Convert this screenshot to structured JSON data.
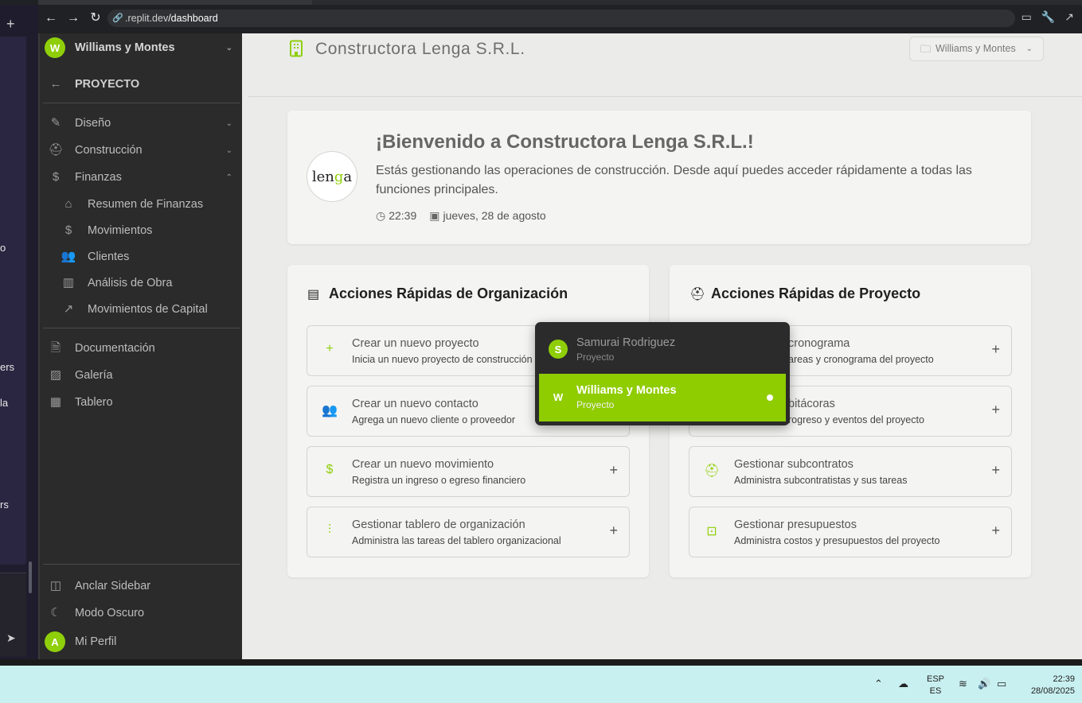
{
  "browser": {
    "url_host": ".replit.dev",
    "url_path": "/dashboard"
  },
  "left_strip": {
    "fragments": [
      "o",
      "ers",
      "la",
      "rs"
    ]
  },
  "sidebar": {
    "org_avatar": "W",
    "org_name": "Williams y Montes",
    "project_label": "PROYECTO",
    "items": [
      {
        "label": "Diseño"
      },
      {
        "label": "Construcción"
      },
      {
        "label": "Finanzas"
      }
    ],
    "finanzas_sub": [
      {
        "label": "Resumen de Finanzas"
      },
      {
        "label": "Movimientos"
      },
      {
        "label": "Clientes"
      },
      {
        "label": "Análisis de Obra"
      },
      {
        "label": "Movimientos de Capital"
      }
    ],
    "items2": [
      {
        "label": "Documentación"
      },
      {
        "label": "Galería"
      },
      {
        "label": "Tablero"
      }
    ],
    "bottom": {
      "pin": "Anclar Sidebar",
      "dark": "Modo Oscuro",
      "profile_avatar": "A",
      "profile": "Mi Perfil"
    }
  },
  "header": {
    "title": "Constructora Lenga S.R.L.",
    "project_select": "Williams y Montes"
  },
  "welcome": {
    "logo_text_a": "len",
    "logo_text_b": "g",
    "logo_text_c": "a",
    "heading": "¡Bienvenido a Constructora Lenga S.R.L.!",
    "text": "Estás gestionando las operaciones de construcción. Desde aquí puedes acceder rápidamente a todas las funciones principales.",
    "time": "22:39",
    "date": "jueves, 28 de agosto"
  },
  "org_actions": {
    "title": "Acciones Rápidas de Organización",
    "items": [
      {
        "title": "Crear un nuevo proyecto",
        "subtitle": "Inicia un nuevo proyecto de construcción"
      },
      {
        "title": "Crear un nuevo contacto",
        "subtitle": "Agrega un nuevo cliente o proveedor"
      },
      {
        "title": "Crear un nuevo movimiento",
        "subtitle": "Registra un ingreso o egreso financiero"
      },
      {
        "title": "Gestionar tablero de organización",
        "subtitle": "Administra las tareas del tablero organizacional"
      }
    ]
  },
  "project_actions": {
    "title": "Acciones Rápidas de Proyecto",
    "items": [
      {
        "title": "cronograma",
        "subtitle": "areas y cronograma del proyecto"
      },
      {
        "title": "bitácoras",
        "subtitle": "rogreso y eventos del proyecto"
      },
      {
        "title": "Gestionar subcontratos",
        "subtitle": "Administra subcontratistas y sus tareas"
      },
      {
        "title": "Gestionar presupuestos",
        "subtitle": "Administra costos y presupuestos del proyecto"
      }
    ]
  },
  "project_dropdown": {
    "items": [
      {
        "avatar": "S",
        "name": "Samurai Rodriguez",
        "role": "Proyecto"
      },
      {
        "avatar": "W",
        "name": "Williams y Montes",
        "role": "Proyecto"
      }
    ]
  },
  "taskbar": {
    "lang_1": "ESP",
    "lang_2": "ES",
    "time": "22:39",
    "date": "28/08/2025"
  },
  "colors": {
    "accent": "#8fcc00",
    "sidebar_bg": "#2b2b2b",
    "main_bg": "#ebebea"
  }
}
